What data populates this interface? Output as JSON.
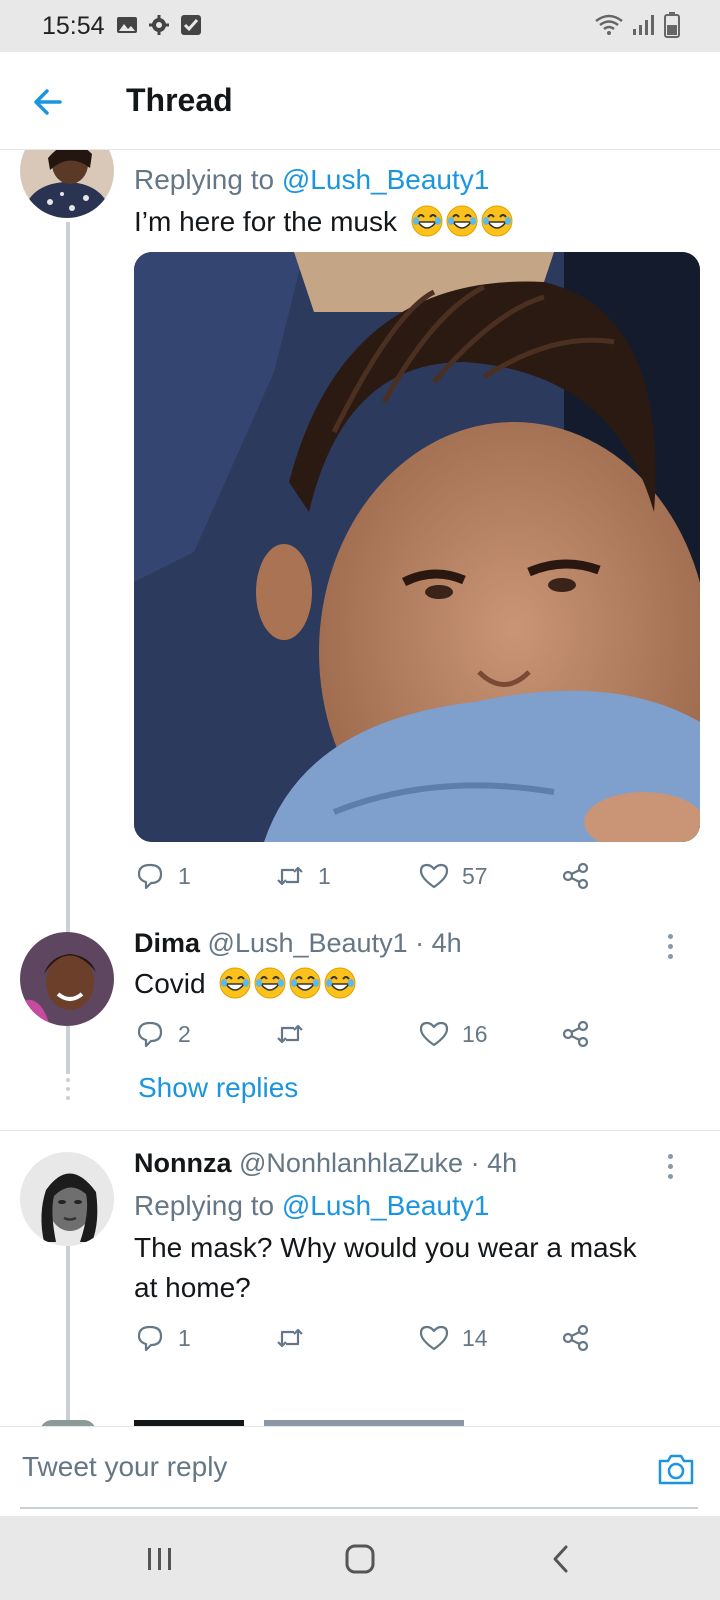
{
  "status_bar": {
    "time": "15:54"
  },
  "header": {
    "title": "Thread"
  },
  "tweets": [
    {
      "replying_prefix": "Replying to ",
      "replying_to": "@Lush_Beauty1",
      "text": "I’m here for the musk",
      "actions": {
        "replies": "1",
        "retweets": "1",
        "likes": "57"
      }
    },
    {
      "name": "Dima",
      "handle": "@Lush_Beauty1",
      "time": "· 4h",
      "text": "Covid",
      "actions": {
        "replies": "2",
        "retweets": "",
        "likes": "16"
      },
      "show_replies": "Show replies"
    },
    {
      "name": "Nonnza",
      "handle": "@NonhlanhlaZuke",
      "time": "· 4h",
      "replying_prefix": "Replying to ",
      "replying_to": "@Lush_Beauty1",
      "text_line1": "The mask? Why would you wear a mask",
      "text_line2": "at home?",
      "actions": {
        "replies": "1",
        "retweets": "",
        "likes": "14"
      }
    }
  ],
  "reply_bar": {
    "placeholder": "Tweet your reply"
  },
  "colors": {
    "accent": "#1b95e0",
    "secondary_text": "#657786",
    "status_bar": "#e8e8e8"
  }
}
